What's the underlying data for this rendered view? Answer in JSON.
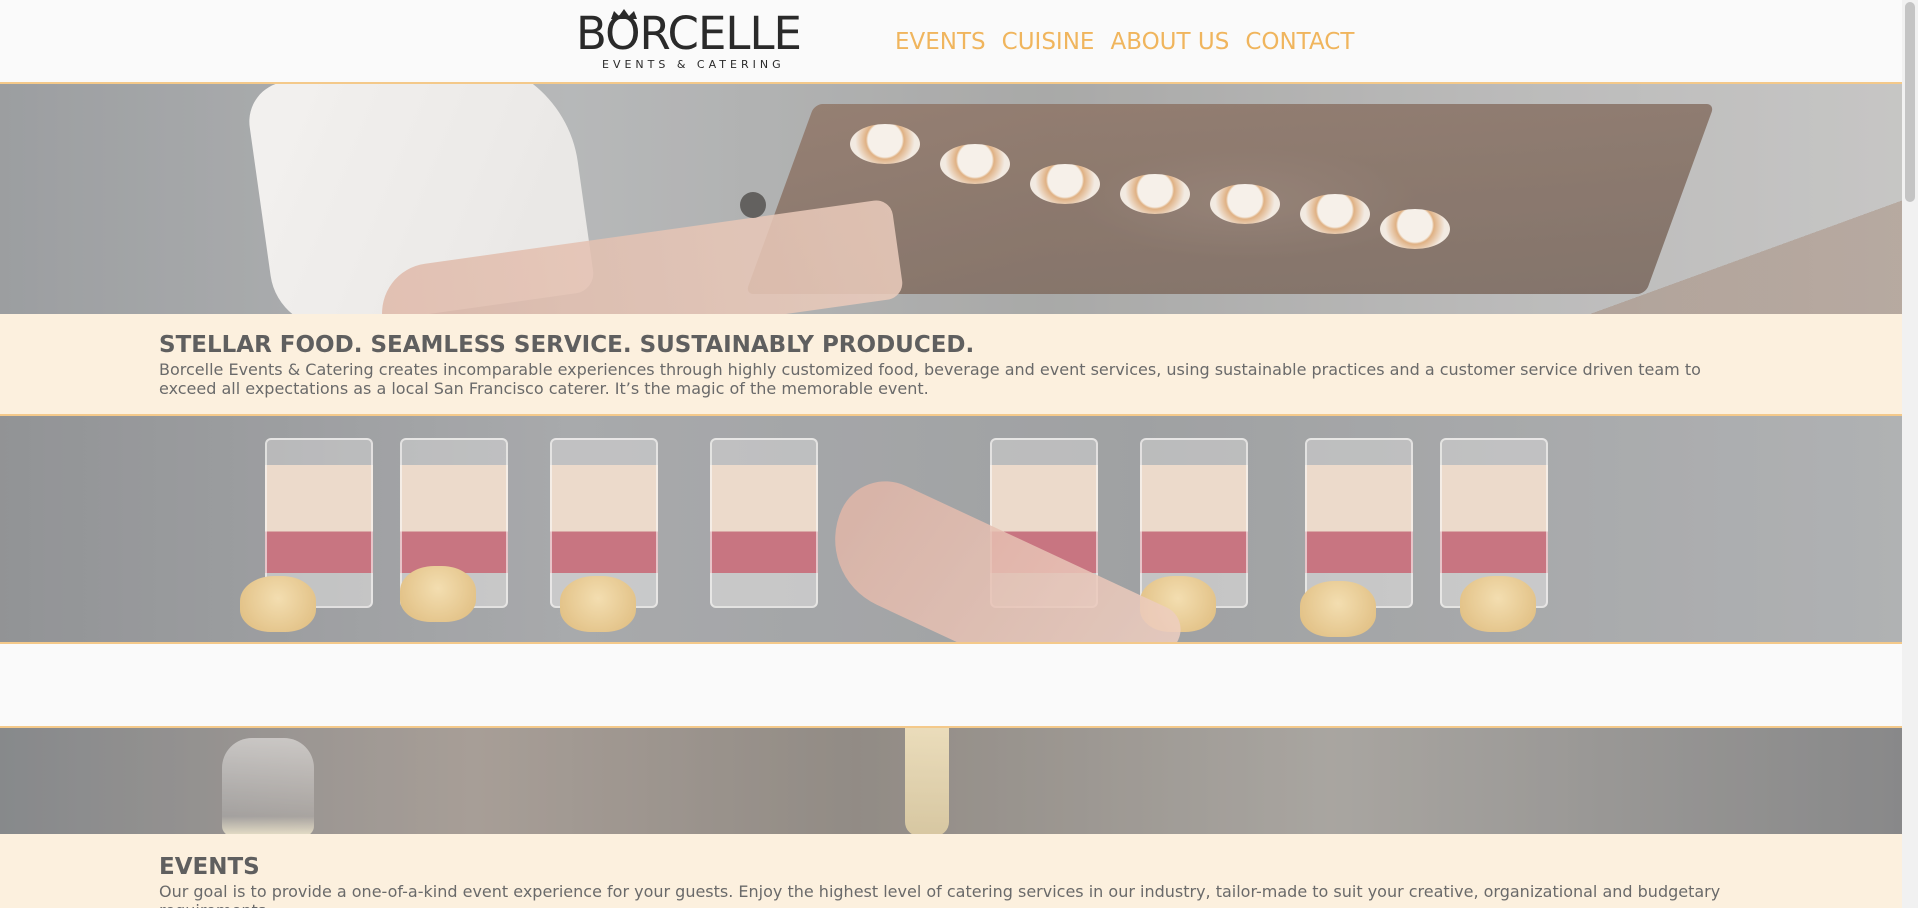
{
  "brand": {
    "name": "BORCELLE",
    "tagline": "EVENTS & CATERING"
  },
  "nav": {
    "items": [
      "EVENTS",
      "CUISINE",
      "ABOUT US",
      "CONTACT"
    ]
  },
  "intro": {
    "headline": "STELLAR FOOD. SEAMLESS SERVICE. SUSTAINABLY PRODUCED.",
    "body": "Borcelle Events & Catering creates incomparable experiences through highly customized food, beverage and event services, using sustainable practices and a customer service driven team to exceed all expectations as a local San Francisco caterer. It’s the magic of the memorable event."
  },
  "events": {
    "headline": "EVENTS",
    "body": "Our goal is to provide a one-of-a-kind event experience for your guests. Enjoy the highest level of catering services in our industry, tailor-made to suit your creative, organizational and budgetary requirements."
  },
  "colors": {
    "accent": "#f0b55d",
    "cream": "#fcf0de",
    "divider": "#f4c98a"
  }
}
